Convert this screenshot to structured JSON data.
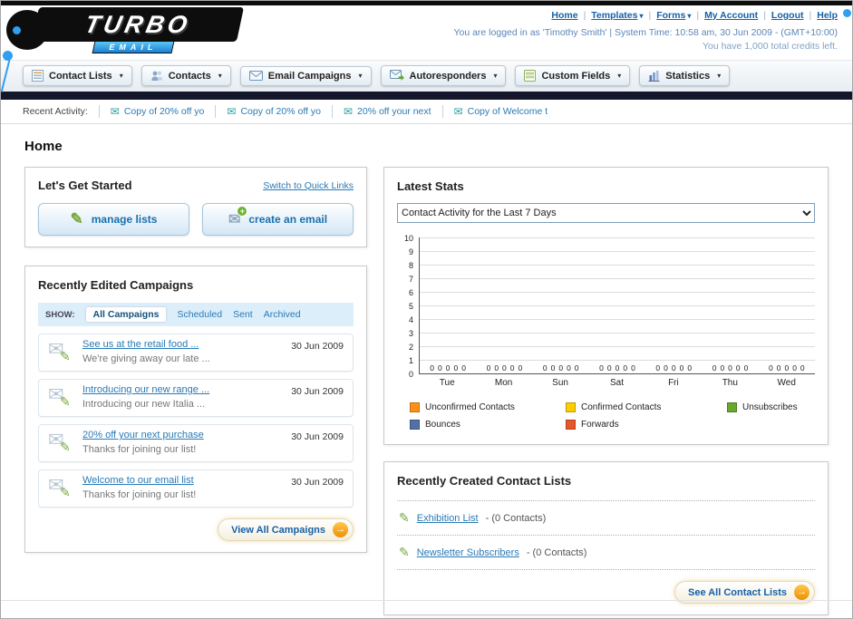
{
  "icons": {
    "chevron": "▾",
    "envelope": "✉",
    "pencil": "✎",
    "plus": "+",
    "arrow": "→"
  },
  "header": {
    "logo_title": "TURBO",
    "logo_subtitle": "EMAIL",
    "nav_links": [
      "Home",
      "Templates",
      "Forms",
      "My Account",
      "Logout",
      "Help"
    ],
    "login_status": "You are logged in as 'Timothy Smith' | System Time: 10:58 am, 30 Jun 2009 - (GMT+10:00)",
    "credits": "You have 1,000 total credits left."
  },
  "nav_tabs": [
    {
      "label": "Contact Lists"
    },
    {
      "label": "Contacts"
    },
    {
      "label": "Email Campaigns"
    },
    {
      "label": "Autoresponders"
    },
    {
      "label": "Custom Fields"
    },
    {
      "label": "Statistics"
    }
  ],
  "recent_activity": {
    "label": "Recent Activity:",
    "items": [
      "Copy of 20% off yo",
      "Copy of 20% off yo",
      "20% off your next",
      "Copy of Welcome t"
    ]
  },
  "page_title": "Home",
  "get_started": {
    "title": "Let's Get Started",
    "switch_link": "Switch to Quick Links",
    "buttons": [
      {
        "label": "manage lists"
      },
      {
        "label": "create an email"
      }
    ]
  },
  "campaigns": {
    "title": "Recently Edited Campaigns",
    "show_label": "SHOW:",
    "filters": [
      "All Campaigns",
      "Scheduled",
      "Sent",
      "Archived"
    ],
    "items": [
      {
        "title": "See us at the retail food ...",
        "subtitle": "We're giving away our late ...",
        "date": "30 Jun 2009"
      },
      {
        "title": "Introducing our new range ...",
        "subtitle": "Introducing our new Italia ...",
        "date": "30 Jun 2009"
      },
      {
        "title": "20% off your next purchase",
        "subtitle": "Thanks for joining our list!",
        "date": "30 Jun 2009"
      },
      {
        "title": "Welcome to our email list",
        "subtitle": "Thanks for joining our list!",
        "date": "30 Jun 2009"
      }
    ],
    "view_all": "View All Campaigns"
  },
  "stats": {
    "title": "Latest Stats",
    "dropdown_value": "Contact Activity for the Last 7 Days",
    "legend": [
      {
        "label": "Unconfirmed Contacts",
        "color": "#ff9216"
      },
      {
        "label": "Confirmed Contacts",
        "color": "#ffcc00"
      },
      {
        "label": "Unsubscribes",
        "color": "#6aa72e"
      },
      {
        "label": "Bounces",
        "color": "#5470a8"
      },
      {
        "label": "Forwards",
        "color": "#e8562a"
      }
    ]
  },
  "chart_data": {
    "type": "bar",
    "title": "Contact Activity for the Last 7 Days",
    "categories": [
      "Tue",
      "Mon",
      "Sun",
      "Sat",
      "Fri",
      "Thu",
      "Wed"
    ],
    "series": [
      {
        "name": "Unconfirmed Contacts",
        "color": "#ff9216",
        "values": [
          0,
          0,
          0,
          0,
          0,
          0,
          0
        ]
      },
      {
        "name": "Confirmed Contacts",
        "color": "#ffcc00",
        "values": [
          0,
          0,
          0,
          0,
          0,
          0,
          0
        ]
      },
      {
        "name": "Unsubscribes",
        "color": "#6aa72e",
        "values": [
          0,
          0,
          0,
          0,
          0,
          0,
          0
        ]
      },
      {
        "name": "Bounces",
        "color": "#5470a8",
        "values": [
          0,
          0,
          0,
          0,
          0,
          0,
          0
        ]
      },
      {
        "name": "Forwards",
        "color": "#e8562a",
        "values": [
          0,
          0,
          0,
          0,
          0,
          0,
          0
        ]
      }
    ],
    "xlabel": "",
    "ylabel": "",
    "ylim": [
      0,
      10
    ],
    "yticks": [
      0,
      1,
      2,
      3,
      4,
      5,
      6,
      7,
      8,
      9,
      10
    ],
    "grid": true,
    "legend_position": "bottom"
  },
  "contact_lists": {
    "title": "Recently Created Contact Lists",
    "items": [
      {
        "name": "Exhibition List",
        "suffix": "- (0 Contacts)"
      },
      {
        "name": "Newsletter Subscribers",
        "suffix": "- (0 Contacts)"
      }
    ],
    "see_all": "See All Contact Lists"
  }
}
